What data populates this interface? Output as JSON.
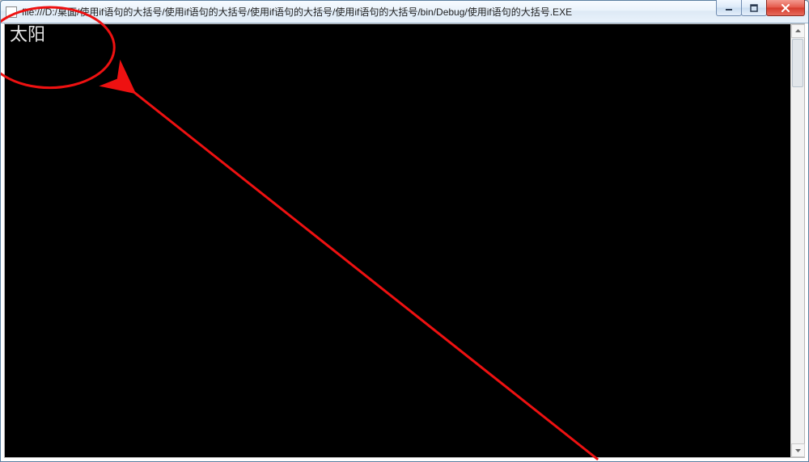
{
  "title": "file:///D:/桌面/使用if语句的大括号/使用if语句的大括号/使用if语句的大括号/使用if语句的大括号/bin/Debug/使用if语句的大括号.EXE",
  "console": {
    "output": "太阳"
  },
  "window_controls": {
    "minimize": "minimize",
    "maximize": "maximize",
    "close": "close"
  }
}
